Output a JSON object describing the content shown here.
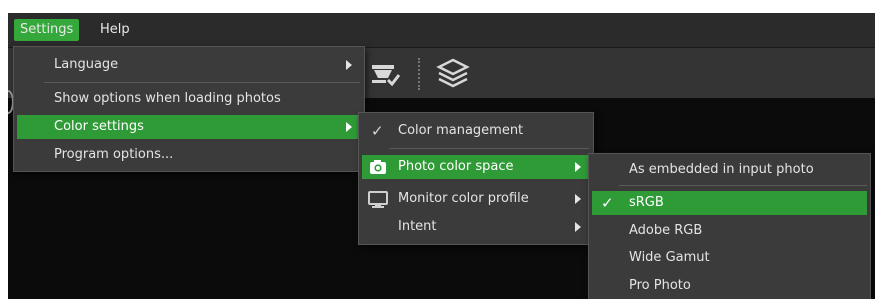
{
  "menubar": {
    "items": [
      {
        "label": "Settings"
      },
      {
        "label": "Help"
      }
    ]
  },
  "toolbar": {
    "icons": [
      "straighten-icon",
      "layers-icon"
    ]
  },
  "settings_menu": {
    "items": [
      {
        "label": "Language",
        "submenu": true
      },
      {
        "label": "Show options when loading photos",
        "submenu": false
      },
      {
        "label": "Color settings",
        "submenu": true,
        "highlighted": true
      },
      {
        "label": "Program options...",
        "submenu": false
      }
    ]
  },
  "color_settings_menu": {
    "items": [
      {
        "label": "Color management",
        "checked": true,
        "icon": "check-icon"
      },
      {
        "label": "Photo color space",
        "submenu": true,
        "highlighted": true,
        "icon": "camera-icon"
      },
      {
        "label": "Monitor color profile",
        "submenu": true,
        "icon": "monitor-icon"
      },
      {
        "label": "Intent",
        "submenu": true
      }
    ]
  },
  "photo_color_space_menu": {
    "items": [
      {
        "label": "As embedded in input photo"
      },
      {
        "label": "sRGB",
        "checked": true,
        "highlighted": true
      },
      {
        "label": "Adobe RGB"
      },
      {
        "label": "Wide Gamut"
      },
      {
        "label": "Pro Photo"
      }
    ]
  },
  "colors": {
    "accent_green": "#2f9b37",
    "menu_bg": "#3b3b3b",
    "menubar_bg": "#2b2b2b",
    "canvas_bg": "#0b0b0b"
  }
}
